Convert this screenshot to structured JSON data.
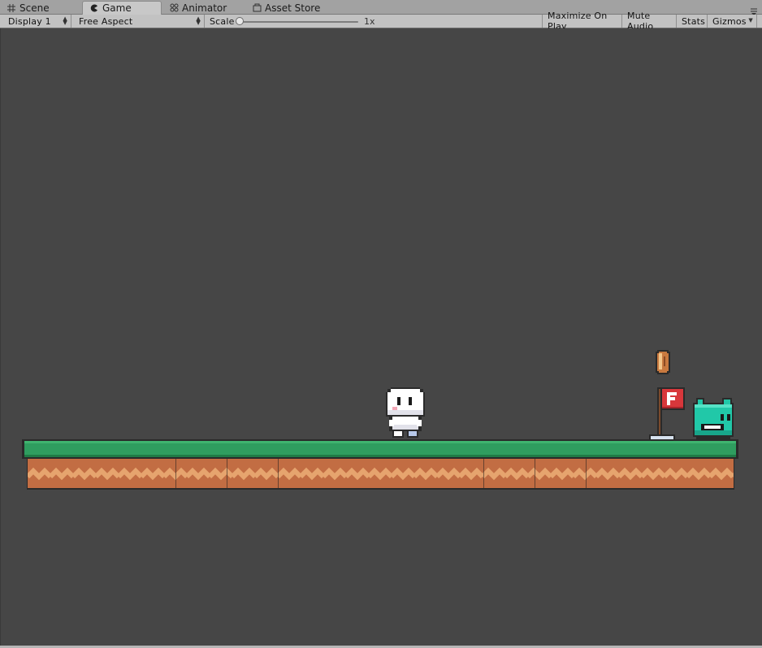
{
  "tabs": [
    {
      "label": "Scene",
      "icon": "grid-icon",
      "active": false
    },
    {
      "label": "Game",
      "icon": "pacman-icon",
      "active": true
    },
    {
      "label": "Animator",
      "icon": "animator-icon",
      "active": false
    },
    {
      "label": "Asset Store",
      "icon": "store-icon",
      "active": false
    }
  ],
  "toolbar": {
    "display": "Display 1",
    "aspect": "Free Aspect",
    "scale_label": "Scale",
    "scale_value": "1x",
    "maximize": "Maximize On Play",
    "mute": "Mute Audio",
    "stats": "Stats",
    "gizmos": "Gizmos"
  },
  "colors": {
    "background": "#464646",
    "grass": "#2f9d5f",
    "dirt": "#c26d43",
    "dirt_wave": "#e6a46e",
    "enemy": "#21c8a8",
    "flag": "#d8373b"
  },
  "scene_objects": [
    "player-character",
    "coin",
    "goal-flag",
    "enemy-slime",
    "ground-platform"
  ]
}
